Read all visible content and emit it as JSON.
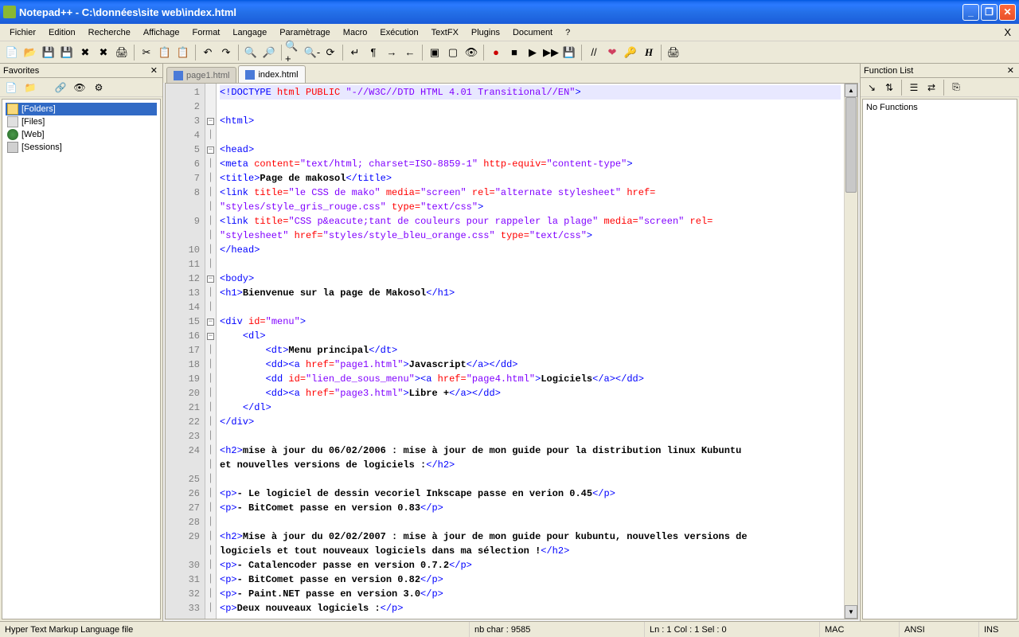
{
  "titlebar": {
    "title": "Notepad++ - C:\\données\\site web\\index.html"
  },
  "menus": [
    "Fichier",
    "Edition",
    "Recherche",
    "Affichage",
    "Format",
    "Langage",
    "Paramètrage",
    "Macro",
    "Exécution",
    "TextFX",
    "Plugins",
    "Document",
    "?"
  ],
  "favorites": {
    "title": "Favorites",
    "items": [
      {
        "label": "[Folders]",
        "icon": "folder",
        "selected": true
      },
      {
        "label": "[Files]",
        "icon": "file",
        "selected": false
      },
      {
        "label": "[Web]",
        "icon": "web",
        "selected": false
      },
      {
        "label": "[Sessions]",
        "icon": "sess",
        "selected": false
      }
    ]
  },
  "tabs": [
    {
      "label": "page1.html",
      "active": false
    },
    {
      "label": "index.html",
      "active": true
    }
  ],
  "code_lines": [
    {
      "n": 1,
      "fold": "",
      "html": "<span class='tag'>&lt;!DOCTYPE</span> <span class='attr'>html PUBLIC </span><span class='str'>\"-//W3C//DTD HTML 4.01 Transitional//EN\"</span><span class='tag'>&gt;</span>",
      "current": true
    },
    {
      "n": 2,
      "fold": "",
      "html": ""
    },
    {
      "n": 3,
      "fold": "⊟",
      "html": "<span class='tag'>&lt;html&gt;</span>"
    },
    {
      "n": 4,
      "fold": "|",
      "html": ""
    },
    {
      "n": 5,
      "fold": "⊟",
      "html": "<span class='tag'>&lt;head&gt;</span>"
    },
    {
      "n": 6,
      "fold": "|",
      "html": "<span class='tag'>&lt;meta</span> <span class='attr'>content=</span><span class='str'>\"text/html; charset=ISO-8859-1\"</span> <span class='attr'>http-equiv=</span><span class='str'>\"content-type\"</span><span class='tag'>&gt;</span>"
    },
    {
      "n": 7,
      "fold": "|",
      "html": "<span class='tag'>&lt;title&gt;</span><span class='txt'>Page de makosol</span><span class='tag'>&lt;/title&gt;</span>"
    },
    {
      "n": 8,
      "fold": "|",
      "html": "<span class='tag'>&lt;link</span> <span class='attr'>title=</span><span class='str'>\"le CSS de mako\"</span> <span class='attr'>media=</span><span class='str'>\"screen\"</span> <span class='attr'>rel=</span><span class='str'>\"alternate stylesheet\"</span> <span class='attr'>href=</span>"
    },
    {
      "n": "",
      "fold": "|",
      "html": "<span class='str'>\"styles/style_gris_rouge.css\"</span> <span class='attr'>type=</span><span class='str'>\"text/css\"</span><span class='tag'>&gt;</span>"
    },
    {
      "n": 9,
      "fold": "|",
      "html": "<span class='tag'>&lt;link</span> <span class='attr'>title=</span><span class='str'>\"CSS p&amp;eacute;tant de couleurs pour rappeler la plage\"</span> <span class='attr'>media=</span><span class='str'>\"screen\"</span> <span class='attr'>rel=</span>"
    },
    {
      "n": "",
      "fold": "|",
      "html": "<span class='str'>\"stylesheet\"</span> <span class='attr'>href=</span><span class='str'>\"styles/style_bleu_orange.css\"</span> <span class='attr'>type=</span><span class='str'>\"text/css\"</span><span class='tag'>&gt;</span>"
    },
    {
      "n": 10,
      "fold": "|",
      "html": "<span class='tag'>&lt;/head&gt;</span>"
    },
    {
      "n": 11,
      "fold": "|",
      "html": ""
    },
    {
      "n": 12,
      "fold": "⊟",
      "html": "<span class='tag'>&lt;body&gt;</span>"
    },
    {
      "n": 13,
      "fold": "|",
      "html": "<span class='tag'>&lt;h1&gt;</span><span class='txt'>Bienvenue sur la page de Makosol</span><span class='tag'>&lt;/h1&gt;</span>"
    },
    {
      "n": 14,
      "fold": "|",
      "html": ""
    },
    {
      "n": 15,
      "fold": "⊟",
      "html": "<span class='tag'>&lt;div</span> <span class='attr'>id=</span><span class='str'>\"menu\"</span><span class='tag'>&gt;</span>"
    },
    {
      "n": 16,
      "fold": "⊟",
      "html": "    <span class='tag'>&lt;dl&gt;</span>"
    },
    {
      "n": 17,
      "fold": "|",
      "html": "        <span class='tag'>&lt;dt&gt;</span><span class='txt'>Menu principal</span><span class='tag'>&lt;/dt&gt;</span>"
    },
    {
      "n": 18,
      "fold": "|",
      "html": "        <span class='tag'>&lt;dd&gt;&lt;a</span> <span class='attr'>href=</span><span class='str'>\"page1.html\"</span><span class='tag'>&gt;</span><span class='txt'>Javascript</span><span class='tag'>&lt;/a&gt;&lt;/dd&gt;</span>"
    },
    {
      "n": 19,
      "fold": "|",
      "html": "        <span class='tag'>&lt;dd</span> <span class='attr'>id=</span><span class='str'>\"lien_de_sous_menu\"</span><span class='tag'>&gt;&lt;a</span> <span class='attr'>href=</span><span class='str'>\"page4.html\"</span><span class='tag'>&gt;</span><span class='txt'>Logiciels</span><span class='tag'>&lt;/a&gt;&lt;/dd&gt;</span>"
    },
    {
      "n": 20,
      "fold": "|",
      "html": "        <span class='tag'>&lt;dd&gt;&lt;a</span> <span class='attr'>href=</span><span class='str'>\"page3.html\"</span><span class='tag'>&gt;</span><span class='txt'>Libre +</span><span class='tag'>&lt;/a&gt;&lt;/dd&gt;</span>"
    },
    {
      "n": 21,
      "fold": "|",
      "html": "    <span class='tag'>&lt;/dl&gt;</span>"
    },
    {
      "n": 22,
      "fold": "|",
      "html": "<span class='tag'>&lt;/div&gt;</span>"
    },
    {
      "n": 23,
      "fold": "|",
      "html": ""
    },
    {
      "n": 24,
      "fold": "|",
      "html": "<span class='tag'>&lt;h2&gt;</span><span class='txt'>mise à jour du 06/02/2006 : mise à jour de mon guide pour la distribution linux Kubuntu</span>"
    },
    {
      "n": "",
      "fold": "|",
      "html": "<span class='txt'>et nouvelles versions de logiciels :</span><span class='tag'>&lt;/h2&gt;</span>"
    },
    {
      "n": 25,
      "fold": "|",
      "html": ""
    },
    {
      "n": 26,
      "fold": "|",
      "html": "<span class='tag'>&lt;p&gt;</span><span class='txt'>- Le logiciel de dessin vecoriel Inkscape passe en verion 0.45</span><span class='tag'>&lt;/p&gt;</span>"
    },
    {
      "n": 27,
      "fold": "|",
      "html": "<span class='tag'>&lt;p&gt;</span><span class='txt'>- BitComet passe en version 0.83</span><span class='tag'>&lt;/p&gt;</span>"
    },
    {
      "n": 28,
      "fold": "|",
      "html": ""
    },
    {
      "n": 29,
      "fold": "|",
      "html": "<span class='tag'>&lt;h2&gt;</span><span class='txt'>Mise à jour du 02/02/2007 : mise à jour de mon guide pour kubuntu, nouvelles versions de</span>"
    },
    {
      "n": "",
      "fold": "|",
      "html": "<span class='txt'>logiciels et tout nouveaux logiciels dans ma sélection !</span><span class='tag'>&lt;/h2&gt;</span>"
    },
    {
      "n": 30,
      "fold": "|",
      "html": "<span class='tag'>&lt;p&gt;</span><span class='txt'>- Catalencoder passe en version 0.7.2</span><span class='tag'>&lt;/p&gt;</span>"
    },
    {
      "n": 31,
      "fold": "|",
      "html": "<span class='tag'>&lt;p&gt;</span><span class='txt'>- BitComet passe en version 0.82</span><span class='tag'>&lt;/p&gt;</span>"
    },
    {
      "n": 32,
      "fold": "|",
      "html": "<span class='tag'>&lt;p&gt;</span><span class='txt'>- Paint.NET passe en version 3.0</span><span class='tag'>&lt;/p&gt;</span>"
    },
    {
      "n": 33,
      "fold": "|",
      "html": "<span class='tag'>&lt;p&gt;</span><span class='txt'>Deux nouveaux logiciels :</span><span class='tag'>&lt;/p&gt;</span>"
    }
  ],
  "func_list": {
    "title": "Function List",
    "content": "No Functions"
  },
  "statusbar": {
    "lang": "Hyper Text Markup Language file",
    "chars": "nb char : 9585",
    "pos": "Ln : 1   Col : 1   Sel : 0",
    "eol": "MAC",
    "enc": "ANSI",
    "mode": "INS"
  },
  "toolbar_icons": [
    "new",
    "open",
    "save",
    "save-all",
    "close",
    "close-all",
    "print",
    "|",
    "cut",
    "copy",
    "paste",
    "|",
    "undo",
    "redo",
    "|",
    "find",
    "replace",
    "|",
    "zoom-in",
    "zoom-out",
    "sync",
    "|",
    "wrap",
    "chars",
    "indent",
    "outdent",
    "|",
    "fold",
    "unfold",
    "hidden",
    "|",
    "rec",
    "stop",
    "play",
    "play-multi",
    "save-macro",
    "|",
    "comment",
    "heart",
    "key",
    "h",
    "|",
    "print2"
  ]
}
